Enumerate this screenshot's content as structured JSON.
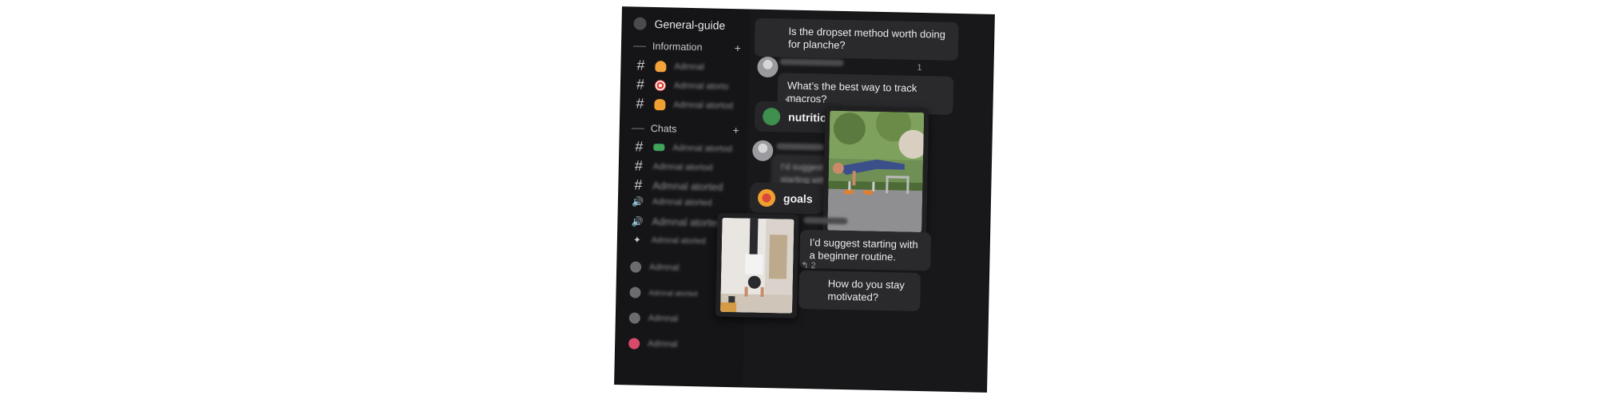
{
  "guild": {
    "name": "General-guide"
  },
  "sidebar": {
    "sections": [
      {
        "title": "Information",
        "add": "+"
      },
      {
        "title": "Chats",
        "add": "+"
      }
    ],
    "channels": [
      {
        "glyph": "#",
        "icon": "bell-icon",
        "color": "#f2a33a",
        "blurred": "Admnal"
      },
      {
        "glyph": "#",
        "icon": "target-icon",
        "color": "#e0453a",
        "blurred": "Admnal atorto"
      },
      {
        "glyph": "#",
        "icon": "hand-icon",
        "color": "#f0a030",
        "blurred": "Admnal atortod"
      },
      {
        "glyph": "#",
        "icon": "green-badge-icon",
        "color": "#3fa35a",
        "blurred": "Admnal atortod"
      },
      {
        "glyph": "#",
        "icon": "",
        "color": "",
        "blurred": "Admnal atortod"
      },
      {
        "glyph": "#",
        "icon": "",
        "color": "",
        "blurred": "Admnal atorted"
      },
      {
        "glyph": "🔊",
        "icon": "speaker-icon",
        "color": "",
        "blurred": "Admnal atorted"
      },
      {
        "glyph": "🔊",
        "icon": "speaker-icon",
        "color": "",
        "blurred": "Admnal atorted"
      },
      {
        "glyph": "✦",
        "icon": "bell-icon",
        "color": "",
        "blurred": "Admnal atorted"
      }
    ],
    "dms": [
      {
        "blurred": "Admnal",
        "color": "#6b6b70"
      },
      {
        "blurred": "Admnal atorted",
        "color": "#6b6b70"
      },
      {
        "blurred": "Admnal",
        "color": "#6b6b70"
      },
      {
        "blurred": "Admnal",
        "color": "#d94a6a"
      }
    ]
  },
  "chat": {
    "messages": [
      {
        "text": "Is the dropset method worth doing for planche?"
      },
      {
        "text": "What’s the best way to track macros?",
        "replies": "1"
      },
      {
        "text": "I’d suggest starting with a beginner routine.",
        "replies": "2"
      },
      {
        "text": "How do you stay motivated?"
      }
    ],
    "tags": [
      {
        "label": "nutrition",
        "color": "#3f8f4f"
      },
      {
        "label": "goals",
        "color": "#f0a030"
      }
    ],
    "side_counts": [
      "1",
      "2"
    ],
    "blurred_message": "I’d suggest starting with a beginner"
  }
}
